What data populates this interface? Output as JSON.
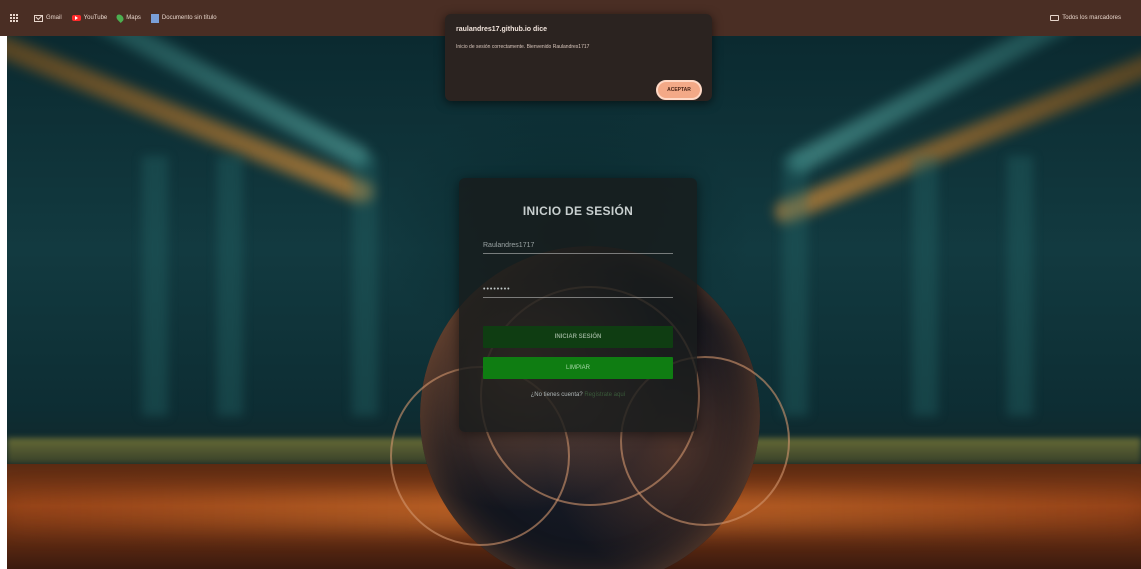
{
  "bookmarks": {
    "items": [
      {
        "label": "Gmail",
        "icon": "gmail-icon"
      },
      {
        "label": "YouTube",
        "icon": "youtube-icon"
      },
      {
        "label": "Maps",
        "icon": "maps-icon"
      },
      {
        "label": "Documento sin título",
        "icon": "document-icon"
      }
    ],
    "all_bookmarks_label": "Todos los marcadores"
  },
  "dialog": {
    "title": "raulandres17.github.io dice",
    "message": "Inicio de sesión correctamente. Bienvenido Raulandres1717",
    "accept_label": "Aceptar"
  },
  "login": {
    "title": "INICIO DE SESIÓN",
    "username_value": "Raulandres1717",
    "password_mask": "••••••••",
    "login_button": "INICIAR SESIÓN",
    "clear_button": "LIMPIAR",
    "register_prompt": "¿No tienes cuenta?",
    "register_link": "Regístrate aquí"
  },
  "colors": {
    "bookmarks_bar": "#4a2e24",
    "dialog_bg": "#2b2320",
    "accept_button": "#f3a987",
    "login_button": "#0f3d12",
    "clear_button": "#0f7d12"
  }
}
